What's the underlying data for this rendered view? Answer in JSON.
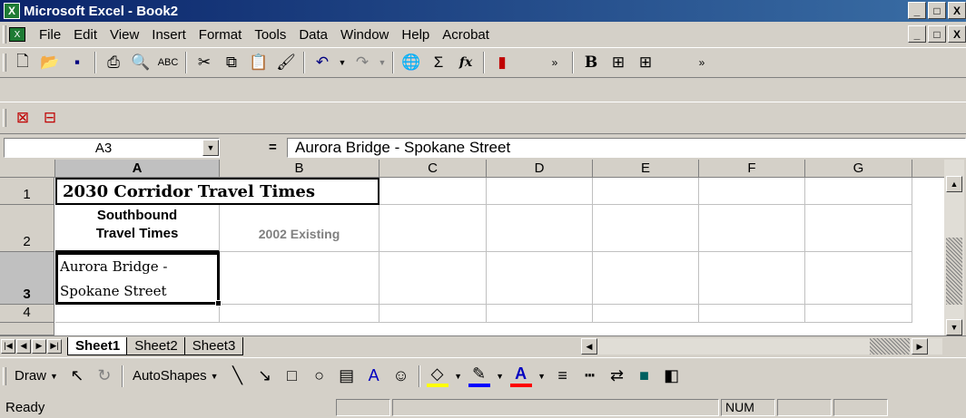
{
  "window": {
    "title": "Microsoft Excel - Book2",
    "app_icon": "excel-icon"
  },
  "window_buttons": {
    "minimize": "_",
    "maximize": "□",
    "close": "X"
  },
  "menu": {
    "items": [
      {
        "label": "File",
        "accel": "F"
      },
      {
        "label": "Edit",
        "accel": "E"
      },
      {
        "label": "View",
        "accel": "V"
      },
      {
        "label": "Insert",
        "accel": "I"
      },
      {
        "label": "Format",
        "accel": "o"
      },
      {
        "label": "Tools",
        "accel": "T"
      },
      {
        "label": "Data",
        "accel": "D"
      },
      {
        "label": "Window",
        "accel": "W"
      },
      {
        "label": "Help",
        "accel": "H"
      },
      {
        "label": "Acrobat",
        "accel": "b"
      }
    ]
  },
  "toolbar": {
    "bold_label": "B",
    "sum_label": "Σ",
    "fx_label": "fx"
  },
  "formula_bar": {
    "name_box": "A3",
    "equals": "=",
    "formula": "Aurora Bridge - Spokane Street"
  },
  "columns": [
    "A",
    "B",
    "C",
    "D",
    "E",
    "F",
    "G"
  ],
  "rows": [
    "1",
    "2",
    "3",
    "4"
  ],
  "cells": {
    "A1": "2030 Corridor Travel Times",
    "A2_line1": "Southbound",
    "A2_line2": "Travel Times",
    "B2": "2002 Existing",
    "A3_line1": "Aurora Bridge -",
    "A3_line2": "Spokane Street"
  },
  "sheets": [
    "Sheet1",
    "Sheet2",
    "Sheet3"
  ],
  "active_sheet": "Sheet1",
  "drawing": {
    "draw_label": "Draw",
    "autoshapes_label": "AutoShapes"
  },
  "status": {
    "text": "Ready",
    "num": "NUM"
  },
  "colors": {
    "title_start": "#0a246a",
    "title_end": "#3a6ea5",
    "chrome": "#d4d0c8"
  }
}
